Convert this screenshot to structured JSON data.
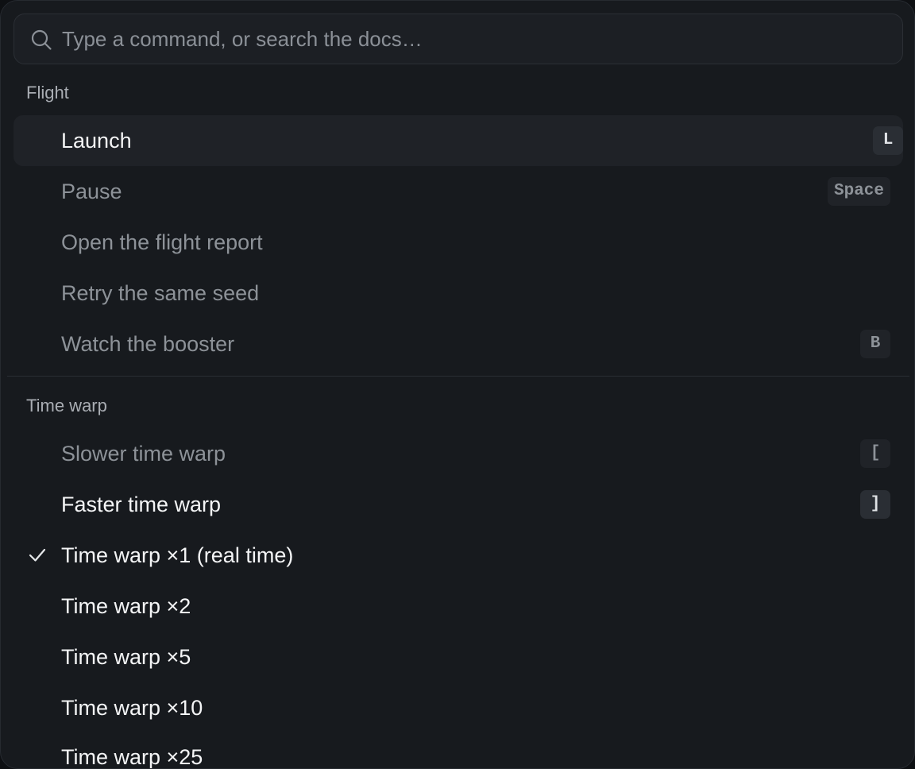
{
  "search": {
    "placeholder": "Type a command, or search the docs…",
    "value": ""
  },
  "groups": [
    {
      "label": "Flight",
      "items": [
        {
          "label": "Launch",
          "shortcut": "L",
          "state": "highlighted"
        },
        {
          "label": "Pause",
          "shortcut": "Space",
          "state": "dim"
        },
        {
          "label": "Open the flight report",
          "shortcut": "",
          "state": "dim"
        },
        {
          "label": "Retry the same seed",
          "shortcut": "",
          "state": "dim"
        },
        {
          "label": "Watch the booster",
          "shortcut": "B",
          "state": "dim"
        }
      ]
    },
    {
      "label": "Time warp",
      "items": [
        {
          "label": "Slower time warp",
          "shortcut": "[",
          "state": "dim"
        },
        {
          "label": "Faster time warp",
          "shortcut": "]",
          "state": "enabled"
        },
        {
          "label": "Time warp ×1 (real time)",
          "shortcut": "",
          "state": "enabled",
          "checked": true
        },
        {
          "label": "Time warp ×2",
          "shortcut": "",
          "state": "enabled"
        },
        {
          "label": "Time warp ×5",
          "shortcut": "",
          "state": "enabled"
        },
        {
          "label": "Time warp ×10",
          "shortcut": "",
          "state": "enabled"
        },
        {
          "label": "Time warp ×25",
          "shortcut": "",
          "state": "enabled"
        }
      ]
    }
  ],
  "icons": {
    "search": "search-icon",
    "check": "check-icon"
  },
  "colors": {
    "panel": "#171a1e",
    "highlight": "#1f2227",
    "text_bright": "#f4f5f6",
    "text_dim": "#8d9298"
  }
}
